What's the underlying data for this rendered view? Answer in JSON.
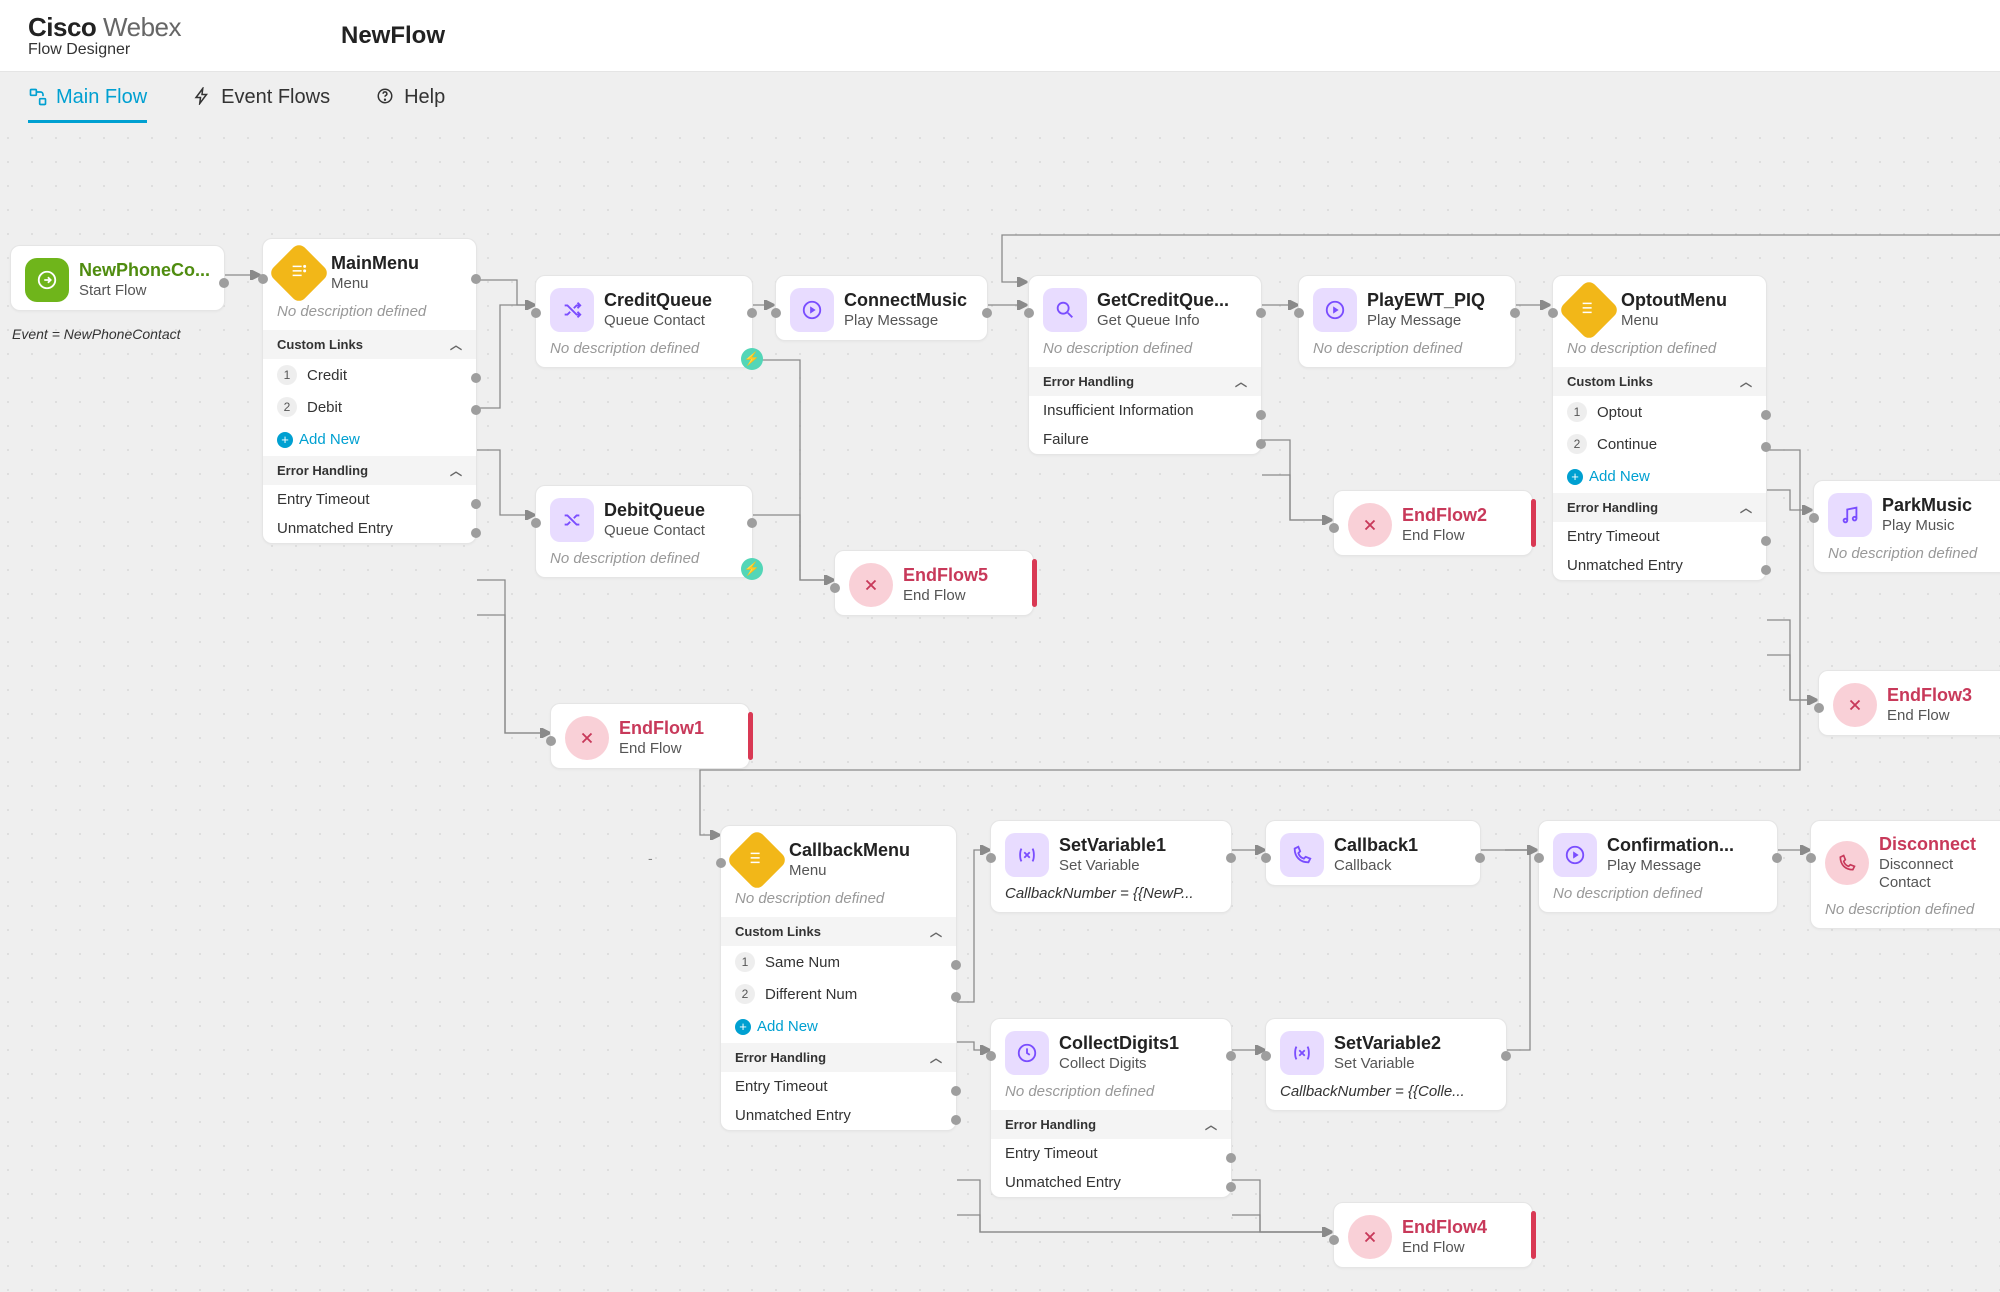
{
  "brand": {
    "name1": "Cisco",
    "name2": "Webex",
    "subtitle": "Flow Designer"
  },
  "flow_name": "NewFlow",
  "tabs": {
    "main": "Main Flow",
    "events": "Event Flows",
    "help": "Help",
    "active": "main"
  },
  "start": {
    "name": "NewPhoneCo...",
    "type": "Start Flow",
    "caption": "Event = NewPhoneContact"
  },
  "main_menu": {
    "name": "MainMenu",
    "type": "Menu",
    "desc": "No description defined",
    "links_title": "Custom Links",
    "links": [
      {
        "n": "1",
        "label": "Credit"
      },
      {
        "n": "2",
        "label": "Debit"
      }
    ],
    "add": "Add New",
    "err_title": "Error Handling",
    "errors": [
      "Entry Timeout",
      "Unmatched Entry"
    ]
  },
  "credit_queue": {
    "name": "CreditQueue",
    "type": "Queue Contact",
    "desc": "No description defined"
  },
  "debit_queue": {
    "name": "DebitQueue",
    "type": "Queue Contact",
    "desc": "No description defined"
  },
  "connect_music": {
    "name": "ConnectMusic",
    "type": "Play Message"
  },
  "get_credit_queue": {
    "name": "GetCreditQue...",
    "type": "Get Queue Info",
    "desc": "No description defined",
    "err_title": "Error Handling",
    "errors": [
      "Insufficient Information",
      "Failure"
    ]
  },
  "play_ewt": {
    "name": "PlayEWT_PIQ",
    "type": "Play Message",
    "desc": "No description defined"
  },
  "optout_menu": {
    "name": "OptoutMenu",
    "type": "Menu",
    "desc": "No description defined",
    "links_title": "Custom Links",
    "links": [
      {
        "n": "1",
        "label": "Optout"
      },
      {
        "n": "2",
        "label": "Continue"
      }
    ],
    "add": "Add New",
    "err_title": "Error Handling",
    "errors": [
      "Entry Timeout",
      "Unmatched Entry"
    ]
  },
  "park_music": {
    "name": "ParkMusic",
    "type": "Play Music",
    "desc": "No description defined"
  },
  "endflow1": {
    "name": "EndFlow1",
    "type": "End Flow"
  },
  "endflow2": {
    "name": "EndFlow2",
    "type": "End Flow"
  },
  "endflow3": {
    "name": "EndFlow3",
    "type": "End Flow"
  },
  "endflow4": {
    "name": "EndFlow4",
    "type": "End Flow"
  },
  "endflow5": {
    "name": "EndFlow5",
    "type": "End Flow"
  },
  "callback_menu": {
    "name": "CallbackMenu",
    "type": "Menu",
    "desc": "No description defined",
    "links_title": "Custom Links",
    "links": [
      {
        "n": "1",
        "label": "Same Num"
      },
      {
        "n": "2",
        "label": "Different Num"
      }
    ],
    "add": "Add New",
    "err_title": "Error Handling",
    "errors": [
      "Entry Timeout",
      "Unmatched Entry"
    ]
  },
  "setvar1": {
    "name": "SetVariable1",
    "type": "Set Variable",
    "line": "CallbackNumber = {{NewP..."
  },
  "setvar2": {
    "name": "SetVariable2",
    "type": "Set Variable",
    "line": "CallbackNumber = {{Colle..."
  },
  "collect_digits": {
    "name": "CollectDigits1",
    "type": "Collect Digits",
    "desc": "No description defined",
    "err_title": "Error Handling",
    "errors": [
      "Entry Timeout",
      "Unmatched Entry"
    ]
  },
  "callback1": {
    "name": "Callback1",
    "type": "Callback"
  },
  "confirmation": {
    "name": "Confirmation...",
    "type": "Play Message",
    "desc": "No description defined"
  },
  "disconnect": {
    "name": "Disconnect",
    "type": "Disconnect Contact",
    "desc": "No description defined"
  }
}
